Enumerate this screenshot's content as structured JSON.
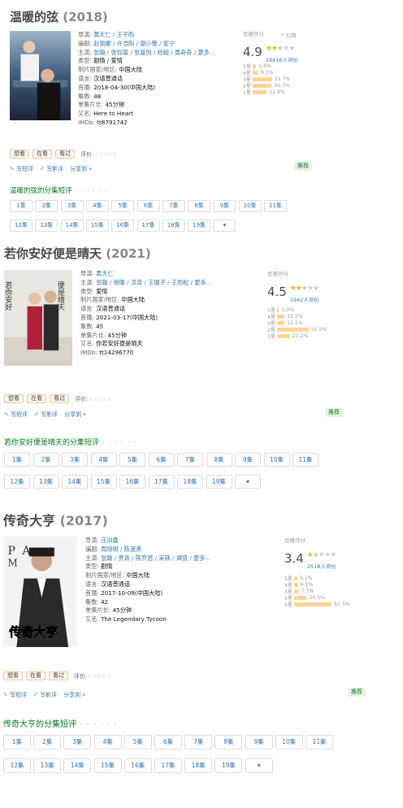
{
  "common": {
    "rating_label": "豆瓣评分",
    "btn_want": "想看",
    "btn_doing": "在看",
    "btn_done": "看过",
    "rate_label": "评价:",
    "empty_stars": "☆☆☆☆☆",
    "write_short": "写短评",
    "write_review": "写影评",
    "share": "分享到",
    "recommend": "推荐",
    "cite": "引用",
    "dots": "· · · · · ·",
    "episodes": [
      "1集",
      "2集",
      "3集",
      "4集",
      "5集",
      "6集",
      "7集",
      "8集",
      "9集",
      "10集",
      "11集",
      "12集",
      "13集",
      "14集",
      "15集",
      "16集",
      "17集",
      "18集",
      "19集"
    ],
    "more_arrow": "▾"
  },
  "dramas": [
    {
      "title": "温暖的弦",
      "year": "(2018)",
      "poster_text": "",
      "info": [
        {
          "label": "导演:",
          "value": "黄天仁 / 王子昀",
          "link": true
        },
        {
          "label": "编剧:",
          "value": "赵丽娜 / 许浩阳 / 谢小蕾 / 安宁",
          "link": true
        },
        {
          "label": "主演:",
          "value": "张翰 / 张钧甯 / 张嘉倪 / 经超 / 周奇奇 / 更多...",
          "link": true
        },
        {
          "label": "类型:",
          "value": "剧情 / 爱情",
          "link": false
        },
        {
          "label": "制片国家/地区:",
          "value": "中国大陆",
          "link": false
        },
        {
          "label": "语言:",
          "value": "汉语普通话",
          "link": false
        },
        {
          "label": "首播:",
          "value": "2018-04-30(中国大陆)",
          "link": false
        },
        {
          "label": "集数:",
          "value": "48",
          "link": false
        },
        {
          "label": "单集片长:",
          "value": "45分钟",
          "link": false
        },
        {
          "label": "又名:",
          "value": "Here to Heart",
          "link": false
        },
        {
          "label": "IMDb:",
          "value": "tt8791742",
          "link": false
        }
      ],
      "score": "4.9",
      "stars_on": 2,
      "stars_half": 1,
      "votes": "19416人评价",
      "show_cite": true,
      "distribution": [
        {
          "level": "5星",
          "pct": "5.6%",
          "value": 5.6
        },
        {
          "level": "4星",
          "pct": "9.1%",
          "value": 9.1
        },
        {
          "level": "3星",
          "pct": "31.7%",
          "value": 31.7
        },
        {
          "level": "2星",
          "pct": "30.7%",
          "value": 30.7
        },
        {
          "level": "1星",
          "pct": "22.9%",
          "value": 22.9
        }
      ],
      "ep_title": "温暖的弦的分集短评"
    },
    {
      "title": "若你安好便是晴天",
      "year": "(2021)",
      "poster_text": "若你安好便是晴天",
      "info": [
        {
          "label": "导演:",
          "value": "黄天仁",
          "link": true
        },
        {
          "label": "主演:",
          "value": "张翰 / 徐璐 / 洪尧 / 王瑞子 / 王劲松 / 更多...",
          "link": true
        },
        {
          "label": "类型:",
          "value": "爱情",
          "link": false
        },
        {
          "label": "制片国家/地区:",
          "value": "中国大陆",
          "link": false
        },
        {
          "label": "语言:",
          "value": "汉语普通话",
          "link": false
        },
        {
          "label": "首播:",
          "value": "2021-03-17(中国大陆)",
          "link": false
        },
        {
          "label": "集数:",
          "value": "45",
          "link": false
        },
        {
          "label": "单集片长:",
          "value": "45分钟",
          "link": false
        },
        {
          "label": "又名:",
          "value": "你若安好便是晴天",
          "link": false
        },
        {
          "label": "IMDb:",
          "value": "tt14296770",
          "link": false
        }
      ],
      "score": "4.5",
      "stars_on": 2,
      "stars_half": 1,
      "votes": "1942人评价",
      "show_cite": false,
      "distribution": [
        {
          "level": "5星",
          "pct": "3.0%",
          "value": 3.0
        },
        {
          "level": "4星",
          "pct": "12.1%",
          "value": 12.1
        },
        {
          "level": "3星",
          "pct": "12.1%",
          "value": 12.1
        },
        {
          "level": "2星",
          "pct": "51.5%",
          "value": 51.5
        },
        {
          "level": "1星",
          "pct": "21.2%",
          "value": 21.2
        }
      ],
      "ep_title": "若你安好便是晴天的分集短评"
    },
    {
      "title": "传奇大亨",
      "year": "(2017)",
      "poster_text": "传奇大亨",
      "info": [
        {
          "label": "导演:",
          "value": "庄训鑫",
          "link": true
        },
        {
          "label": "编剧:",
          "value": "周旭明 / 陈淑贤",
          "link": true
        },
        {
          "label": "主演:",
          "value": "张翰 / 贾青 / 陈乔恩 / 宋轶 / 谭凯 / 更多...",
          "link": true
        },
        {
          "label": "类型:",
          "value": "剧情",
          "link": false
        },
        {
          "label": "制片国家/地区:",
          "value": "中国大陆",
          "link": false
        },
        {
          "label": "语言:",
          "value": "汉语普通话",
          "link": false
        },
        {
          "label": "首播:",
          "value": "2017-10-09(中国大陆)",
          "link": false
        },
        {
          "label": "集数:",
          "value": "42",
          "link": false
        },
        {
          "label": "单集片长:",
          "value": "45分钟",
          "link": false
        },
        {
          "label": "又名:",
          "value": "The Legendary Tycoon",
          "link": false
        }
      ],
      "score": "3.4",
      "stars_on": 1,
      "stars_half": 1,
      "votes": "2518人评价",
      "show_cite": false,
      "distribution": [
        {
          "level": "5星",
          "pct": "5.1%",
          "value": 5.1
        },
        {
          "level": "4星",
          "pct": "6.1%",
          "value": 6.1
        },
        {
          "level": "3星",
          "pct": "7.7%",
          "value": 7.7
        },
        {
          "level": "2星",
          "pct": "20.5%",
          "value": 20.5
        },
        {
          "level": "1星",
          "pct": "61.5%",
          "value": 61.5
        }
      ],
      "ep_title": "传奇大亨的分集短评"
    }
  ]
}
